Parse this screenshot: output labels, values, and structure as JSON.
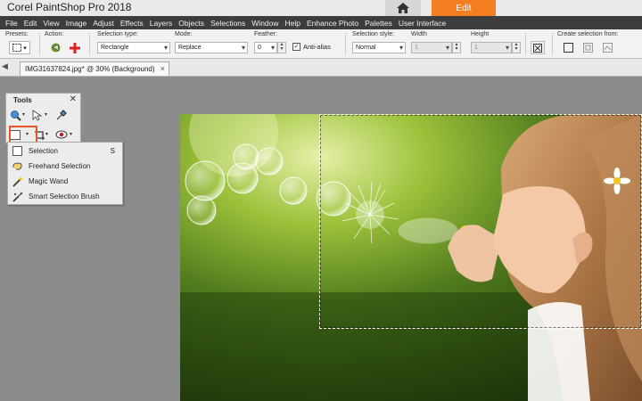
{
  "app": {
    "title": "Corel PaintShop Pro 2018",
    "edit_tab": "Edit"
  },
  "menu": [
    "File",
    "Edit",
    "View",
    "Image",
    "Adjust",
    "Effects",
    "Layers",
    "Objects",
    "Selections",
    "Window",
    "Help",
    "Enhance Photo",
    "Palettes",
    "User Interface"
  ],
  "options": {
    "presets_label": "Presets:",
    "action_label": "Action:",
    "selection_type_label": "Selection type:",
    "selection_type_value": "Rectangle",
    "mode_label": "Mode:",
    "mode_value": "Replace",
    "feather_label": "Feather:",
    "feather_value": "0",
    "antialias_label": "Anti-alias",
    "antialias_checked": true,
    "selection_style_label": "Selection style:",
    "selection_style_value": "Normal",
    "width_label": "Width",
    "width_value": "1",
    "height_label": "Height",
    "height_value": "1",
    "create_selection_label": "Create selection from:"
  },
  "document": {
    "tab_label": "IMG31637824.jpg* @  30% (Background)",
    "close_icon": "×"
  },
  "tools_panel": {
    "title": "Tools",
    "close_icon": "✕"
  },
  "flyout": {
    "items": [
      {
        "label": "Selection",
        "shortcut": "S",
        "icon": "rect-selection-icon"
      },
      {
        "label": "Freehand Selection",
        "shortcut": "",
        "icon": "freehand-selection-icon"
      },
      {
        "label": "Magic Wand",
        "shortcut": "",
        "icon": "magic-wand-icon"
      },
      {
        "label": "Smart Selection Brush",
        "shortcut": "",
        "icon": "smart-brush-icon"
      }
    ]
  },
  "colors": {
    "accent": "#f47d20",
    "menubar": "#3d3d3d",
    "highlight": "#e8542a"
  }
}
